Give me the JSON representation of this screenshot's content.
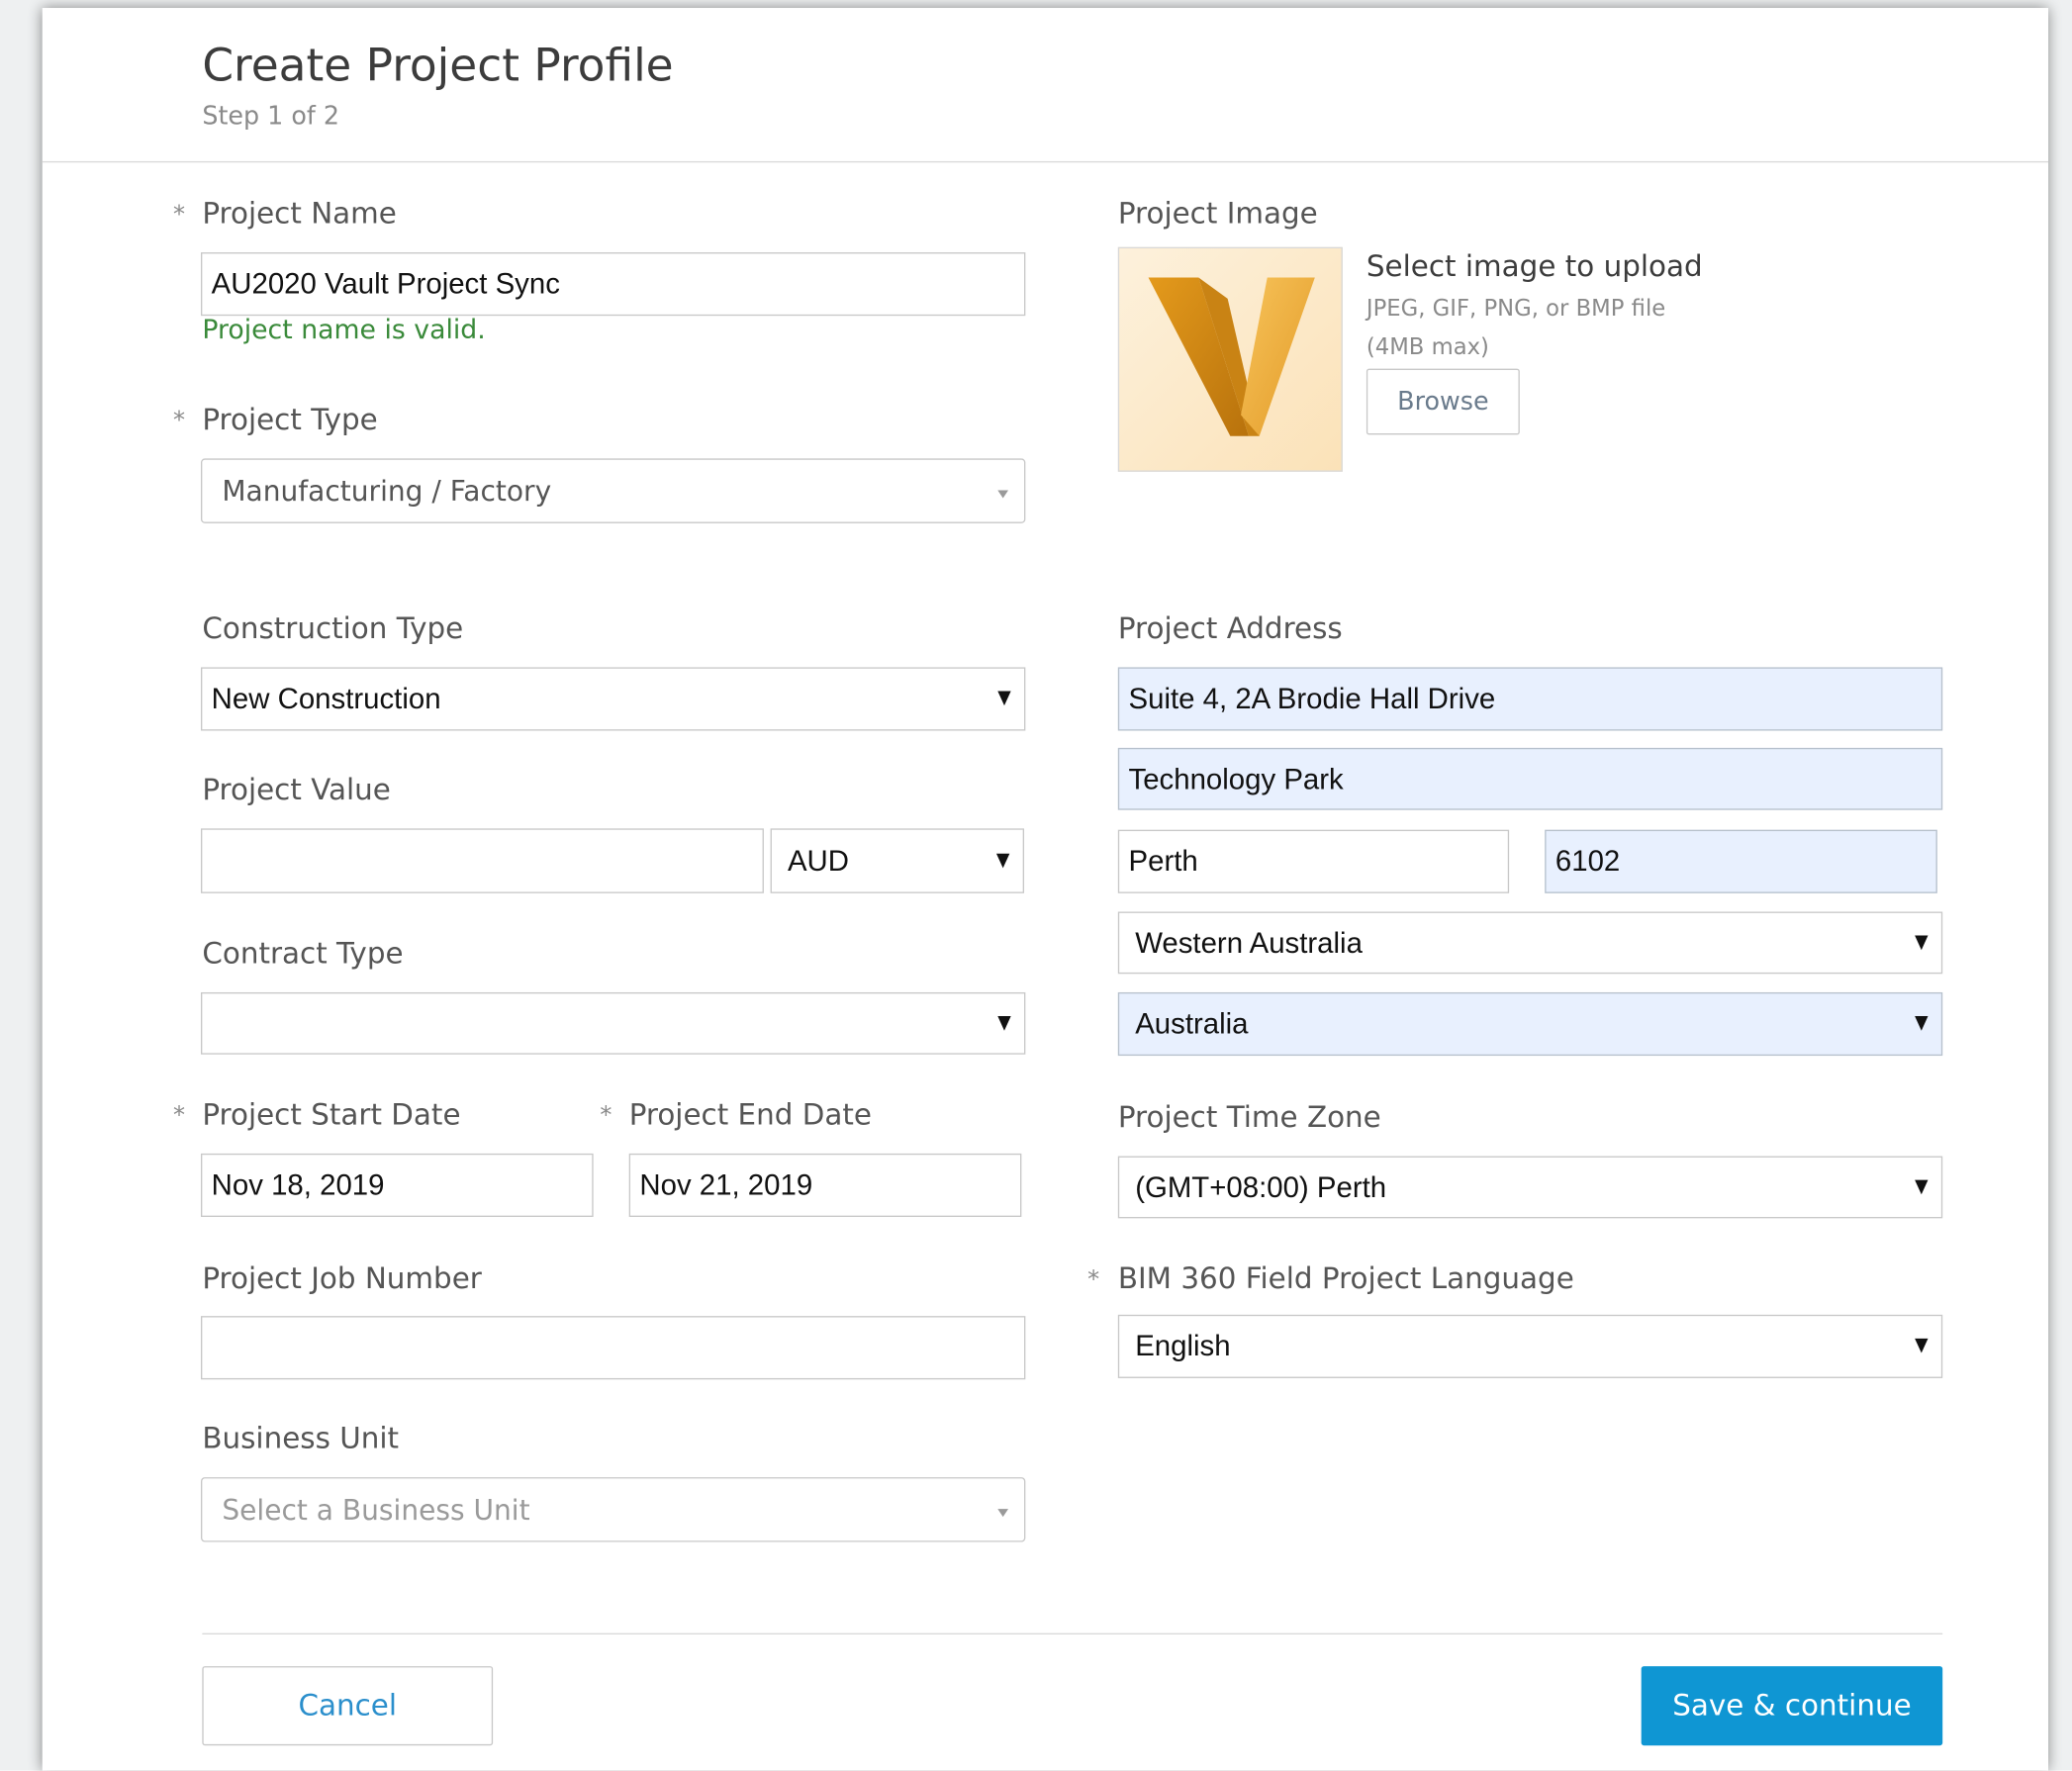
{
  "header": {
    "title": "Create Project Profile",
    "step": "Step 1 of 2"
  },
  "form": {
    "required_mark": "*",
    "project_name": {
      "label": "Project Name",
      "value": "AU2020 Vault Project Sync",
      "validation": "Project name is valid."
    },
    "project_type": {
      "label": "Project Type",
      "value": "Manufacturing / Factory"
    },
    "construction_type": {
      "label": "Construction Type",
      "value": "New Construction"
    },
    "project_value": {
      "label": "Project Value",
      "value": "",
      "currency": "AUD"
    },
    "contract_type": {
      "label": "Contract Type",
      "value": ""
    },
    "start_date": {
      "label": "Project Start Date",
      "value": "Nov 18, 2019"
    },
    "end_date": {
      "label": "Project End Date",
      "value": "Nov 21, 2019"
    },
    "job_number": {
      "label": "Project Job Number",
      "value": ""
    },
    "business_unit": {
      "label": "Business Unit",
      "placeholder": "Select a Business Unit"
    },
    "project_image": {
      "label": "Project Image",
      "upload_title": "Select image to upload",
      "hint_line1": "JPEG, GIF, PNG, or BMP file",
      "hint_line2": "(4MB max)",
      "browse_label": "Browse"
    },
    "address": {
      "label": "Project Address",
      "line1": "Suite 4, 2A Brodie Hall Drive",
      "line2": "Technology Park",
      "city": "Perth",
      "postcode": "6102",
      "state": "Western Australia",
      "country": "Australia"
    },
    "time_zone": {
      "label": "Project Time Zone",
      "value": "(GMT+08:00) Perth"
    },
    "language": {
      "label": "BIM 360 Field Project Language",
      "value": "English"
    }
  },
  "footer": {
    "cancel_label": "Cancel",
    "save_label": "Save & continue"
  },
  "colors": {
    "primary_button": "#0f96d3",
    "link": "#2b8fcc",
    "valid": "#3a8a3a",
    "autofill_background": "#e8f0fe"
  },
  "icons": {
    "logo": "autodesk-vault-logo",
    "select_arrow": "caret-down-icon"
  }
}
